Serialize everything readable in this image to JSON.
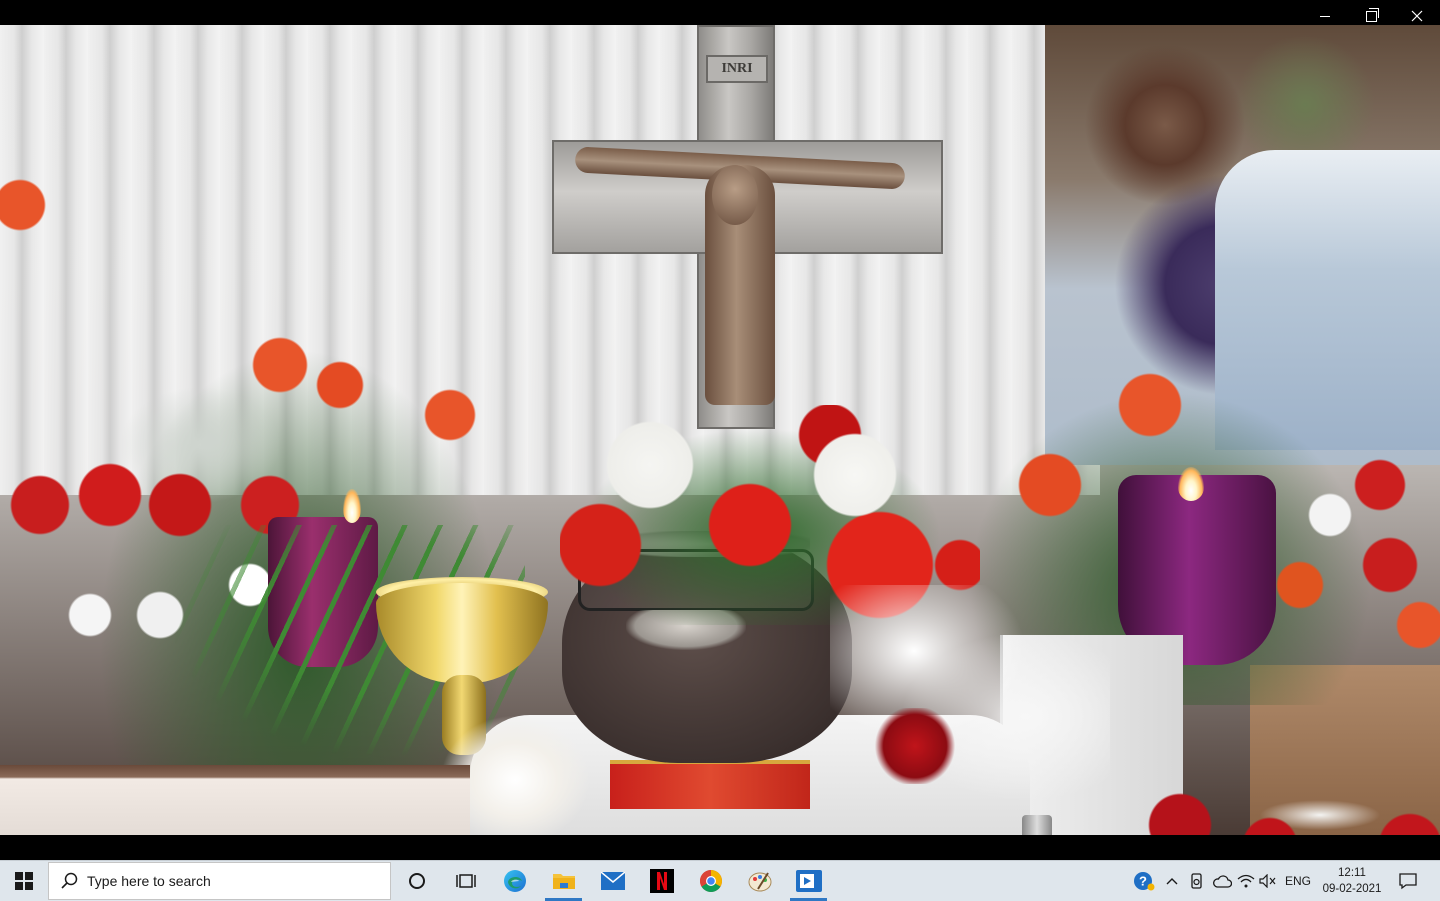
{
  "window": {
    "controls": {
      "minimize_icon": "minimize-icon",
      "maximize_icon": "restore-icon",
      "close_icon": "close-icon"
    }
  },
  "media": {
    "inri_plate_text": "INRI"
  },
  "taskbar": {
    "search": {
      "placeholder": "Type here to search"
    },
    "pinned_apps": [
      {
        "name": "cortana",
        "icon": "cortana-icon"
      },
      {
        "name": "task-view",
        "icon": "task-view-icon"
      },
      {
        "name": "edge",
        "icon": "edge-icon"
      },
      {
        "name": "file-explorer",
        "icon": "folder-icon"
      },
      {
        "name": "mail",
        "icon": "mail-icon"
      },
      {
        "name": "netflix",
        "icon": "netflix-icon"
      },
      {
        "name": "chrome",
        "icon": "chrome-icon"
      },
      {
        "name": "paint",
        "icon": "paint-icon"
      },
      {
        "name": "media-player",
        "icon": "media-player-icon"
      }
    ],
    "tray": {
      "language": "ENG",
      "time": "12:11",
      "date": "09-02-2021"
    }
  },
  "colors": {
    "taskbar_bg": "#dfe6ec",
    "active_indicator": "#2f78c4",
    "netflix_red": "#e50914"
  }
}
